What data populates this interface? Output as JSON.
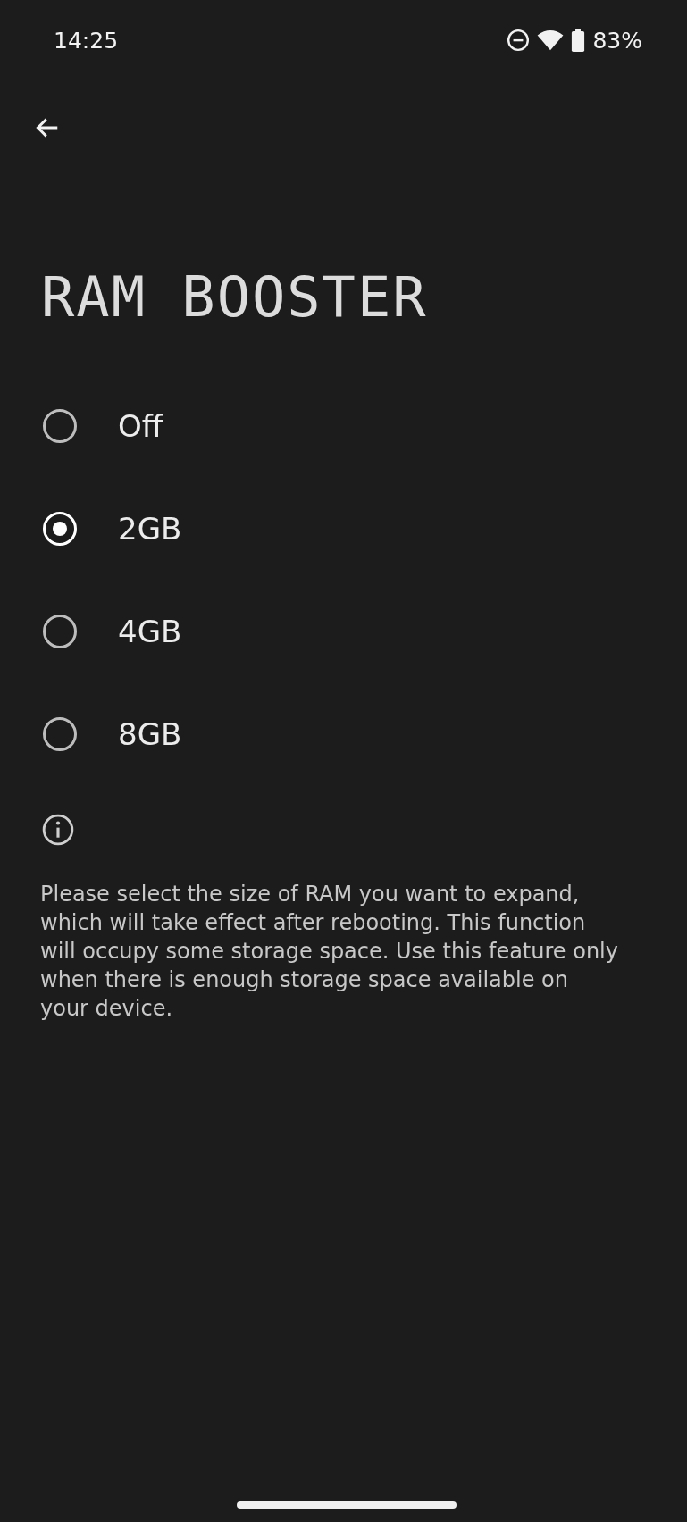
{
  "status_bar": {
    "time": "14:25",
    "battery": "83%"
  },
  "title": "RAM BOOSTER",
  "options": [
    {
      "label": "Off",
      "selected": false
    },
    {
      "label": "2GB",
      "selected": true
    },
    {
      "label": "4GB",
      "selected": false
    },
    {
      "label": "8GB",
      "selected": false
    }
  ],
  "info": "Please select the size of RAM you want to expand, which will take effect after rebooting. This function will occupy some storage space. Use this feature only when there is enough storage space available on your device."
}
